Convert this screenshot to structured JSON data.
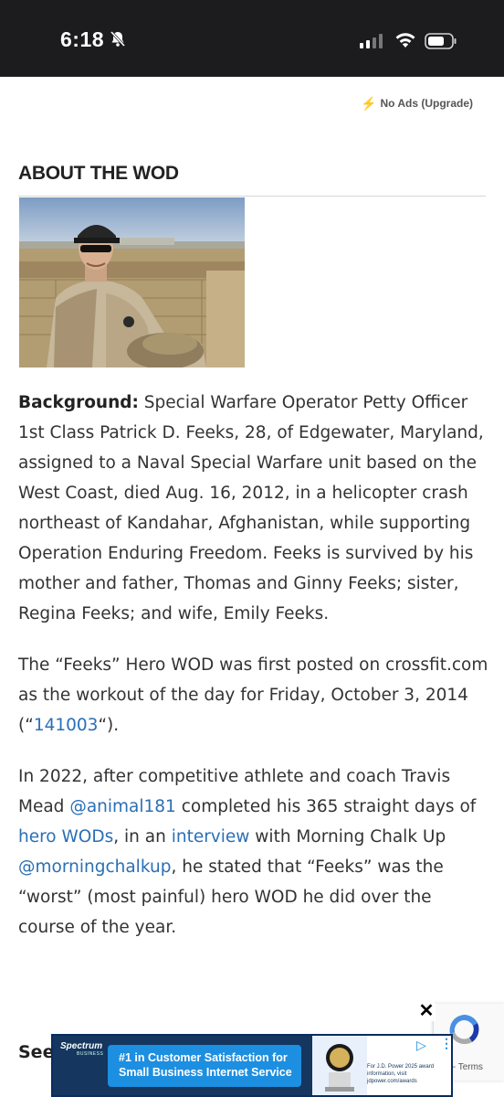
{
  "status_bar": {
    "time": "6:18",
    "icons": [
      "bell-slash-icon",
      "signal-icon",
      "wifi-icon",
      "battery-icon"
    ]
  },
  "header": {
    "no_ads_label": "No Ads (Upgrade)"
  },
  "section": {
    "title": "ABOUT THE WOD"
  },
  "article": {
    "background_label": "Background:",
    "background_text": " Special Warfare Operator Petty Officer 1st Class Patrick D. Feeks, 28, of Edgewater, Maryland, assigned to a Naval Special Warfare unit based on the West Coast, died Aug. 16, 2012, in a helicopter crash northeast of Kandahar, Afghanistan, while supporting Operation Enduring Freedom. Feeks is survived by his mother and father, Thomas and Ginny Feeks; sister, Regina Feeks; and wife, Emily Feeks.",
    "p2_before": "The “Feeks” Hero WOD was first posted on crossfit.com as the workout of the day for Friday, October 3, 2014 (“",
    "p2_link": "141003",
    "p2_after": "“).",
    "p3_a": "In 2022, after competitive athlete and coach Travis Mead ",
    "p3_link1": "@animal181",
    "p3_b": " completed his 365 straight days of ",
    "p3_link2": "hero WODs",
    "p3_c": ", in an ",
    "p3_link3": "interview",
    "p3_d": " with Morning Chalk Up ",
    "p3_link4": "@morningchalkup",
    "p3_e": ", he stated that “Feeks” was the “worst” (most painful) hero WOD he did over the course of the year.",
    "see_partial": "See"
  },
  "recaptcha": {
    "privacy_terms": "cy - Terms"
  },
  "ad": {
    "close_label": "✕",
    "brand": "Spectrum",
    "brand_sub": "BUSINESS",
    "headline": "#1 in Customer Satisfaction for Small Business Internet Service",
    "fine_print": "For J.D. Power 2025 award information, visit jdpower.com/awards"
  },
  "colors": {
    "link": "#2a6fb5",
    "status_bar_bg": "#1c1c1e",
    "ad_navy": "#14365f",
    "ad_blue": "#1d8fe0",
    "bolt": "#f5a623"
  }
}
